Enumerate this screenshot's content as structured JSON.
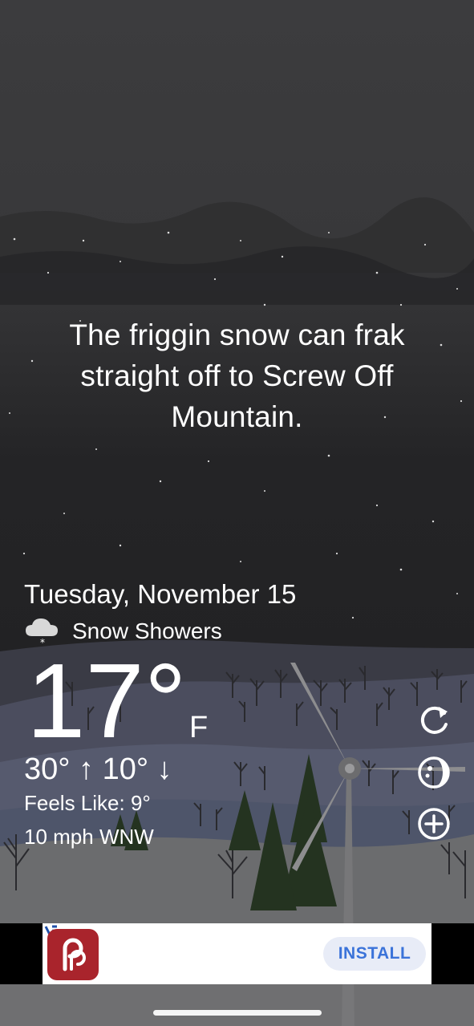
{
  "message": {
    "line1": "The friggin snow can frak",
    "line2": "straight off to Screw Off",
    "line3": "Mountain."
  },
  "weather": {
    "date": "Tuesday, November 15",
    "condition_icon": "cloud-snow-icon",
    "condition": "Snow Showers",
    "temperature": "17°",
    "unit": "F",
    "hi_lo": "30° ↑ 10° ↓",
    "feels_like": "Feels Like: 9°",
    "wind": "10 mph WNW"
  },
  "controls": {
    "icons": [
      "refresh-icon",
      "theme-icon",
      "add-icon"
    ]
  },
  "ad": {
    "logo_icon": "pinterest-style-app-icon",
    "install_label": "INSTALL",
    "install_color": "#3b73d9"
  }
}
